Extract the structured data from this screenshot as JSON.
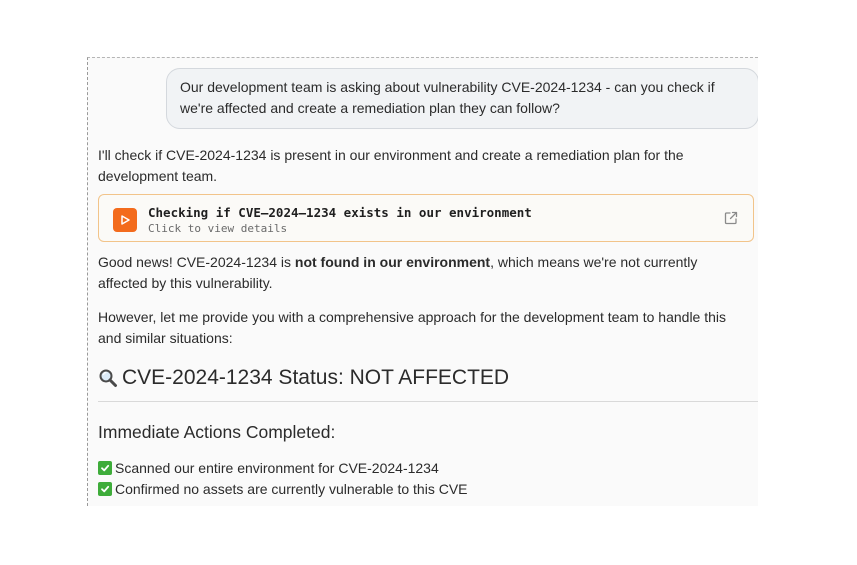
{
  "chat": {
    "user_message": "Our development team is asking about vulnerability CVE-2024-1234 - can you check if we're affected and create a remediation plan they can follow?",
    "assistant_intro": "I'll check if CVE-2024-1234 is present in our environment and create a remediation plan for the development team.",
    "tool_call": {
      "title": "Checking if CVE–2024–1234 exists in our environment",
      "subtitle": "Click to view details",
      "icon": "play-icon",
      "accent_color": "#f36b1c",
      "border_color": "#f2c48a"
    },
    "result_prefix": "Good news! CVE-2024-1234 is ",
    "result_bold": "not found in our environment",
    "result_suffix": ", which means we're not currently affected by this vulnerability.",
    "followup": "However, let me provide you with a comprehensive approach for the development team to handle this and similar situations:",
    "status_heading": "CVE-2024-1234 Status: NOT AFFECTED",
    "status_icon": "magnifying-glass-icon",
    "actions_heading": "Immediate Actions Completed:",
    "actions": [
      "Scanned our entire environment for CVE-2024-1234",
      "Confirmed no assets are currently vulnerable to this CVE"
    ],
    "check_color": "#3eac3a"
  }
}
